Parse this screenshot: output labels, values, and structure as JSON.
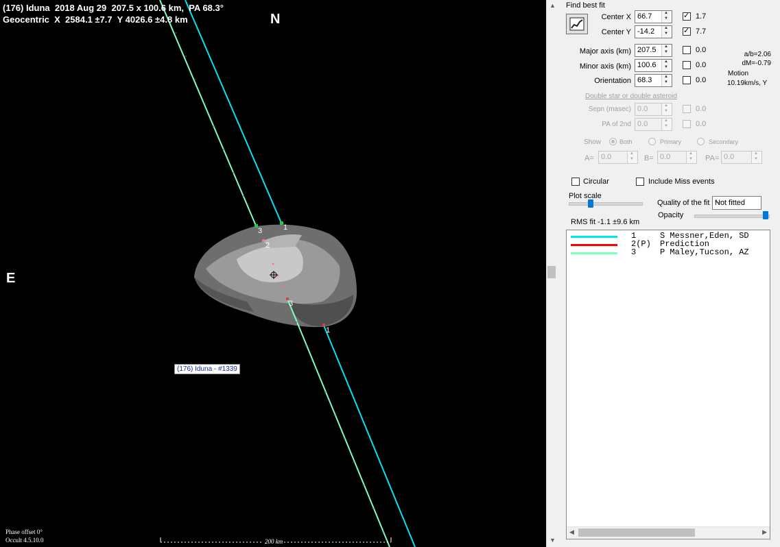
{
  "plot": {
    "header_line1": "(176) Iduna  2018 Aug 29  207.5 x 100.6 km,  PA 68.3°",
    "header_line2": "Geocentric  X  2584.1 ±7.7  Y 4026.6 ±4.8 km",
    "north": "N",
    "east": "E",
    "object_label": "(176) Iduna - #1339",
    "phase_offset": "Phase offset 0°",
    "version": "Occult 4.5.10.0",
    "scale_label": "200 km",
    "chord_labels": [
      "1",
      "3",
      "2",
      "3",
      "1"
    ],
    "colors": {
      "chord1": "#00e5f0",
      "chord3": "#7fffc0",
      "background": "#000000"
    }
  },
  "panel": {
    "find_best_fit": "Find best fit",
    "center_x": {
      "label": "Center X",
      "value": "66.7",
      "checked": true,
      "uncert": "1.7"
    },
    "center_y": {
      "label": "Center Y",
      "value": "-14.2",
      "checked": true,
      "uncert": "7.7"
    },
    "major_axis": {
      "label": "Major axis (km)",
      "value": "207.5",
      "checked": false,
      "uncert": "0.0"
    },
    "minor_axis": {
      "label": "Minor axis (km)",
      "value": "100.6",
      "checked": false,
      "uncert": "0.0"
    },
    "orientation": {
      "label": "Orientation",
      "value": "68.3",
      "checked": false,
      "uncert": "0.0"
    },
    "ab_ratio": "a/b=2.06",
    "dm": "dM=-0.79",
    "motion_label": "Motion",
    "motion_value": "10.19km/s, Y",
    "double_star": "Double star  or  double asteroid",
    "sepn": {
      "label": "Sepn (masec)",
      "value": "0.0",
      "uncert": "0.0"
    },
    "pa2nd": {
      "label": "PA of 2nd",
      "value": "0.0",
      "uncert": "0.0"
    },
    "show_label": "Show",
    "radio_both": "Both",
    "radio_primary": "Primary",
    "radio_secondary": "Secondary",
    "a_label": "A=",
    "a_value": "0.0",
    "b_label": "B=",
    "b_value": "0.0",
    "pa_label": "PA=",
    "pa_value": "0.0",
    "circular": "Circular",
    "include_miss": "Include Miss events",
    "plot_scale": "Plot scale",
    "quality_label": "Quality of the fit",
    "quality_value": "Not fitted",
    "opacity": "Opacity",
    "rms_fit": "RMS fit -1.1 ±9.6 km"
  },
  "legend": [
    {
      "num": "1",
      "text": "S Messner,Eden, SD",
      "color": "#00e5f0"
    },
    {
      "num": "2(P)",
      "text": "Prediction",
      "color": "#ff0000"
    },
    {
      "num": "3",
      "text": "P Maley,Tucson, AZ",
      "color": "#7fffc0"
    }
  ]
}
